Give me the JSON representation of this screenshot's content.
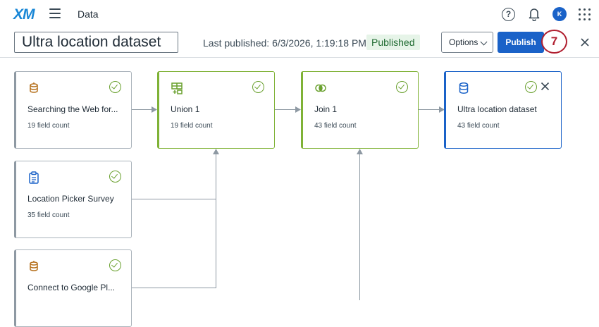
{
  "header": {
    "logo": "XM",
    "app_title": "Data",
    "avatar_initial": "K"
  },
  "toolbar": {
    "dataset_name": "Ultra location dataset",
    "last_published": "Last published: 6/3/2026, 1:19:18 PM",
    "status": "Published",
    "options_label": "Options",
    "publish_label": "Publish",
    "step_number": "7"
  },
  "nodes": [
    {
      "title": "Searching the Web for...",
      "count": "19 field count",
      "icon": "stack-coins-icon",
      "status": "check-icon"
    },
    {
      "title": "Union 1",
      "count": "19 field count",
      "icon": "union-table-icon",
      "status": "check-icon"
    },
    {
      "title": "Join 1",
      "count": "43 field count",
      "icon": "join-circles-icon",
      "status": "check-icon"
    },
    {
      "title": "Ultra location dataset",
      "count": "43 field count",
      "icon": "database-icon",
      "status": "check-icon"
    },
    {
      "title": "Location Picker Survey",
      "count": "35 field count",
      "icon": "survey-clipboard-icon",
      "status": "check-icon"
    },
    {
      "title": "Connect to Google Pl...",
      "count": "",
      "icon": "stack-coins-icon",
      "status": "check-icon"
    }
  ],
  "colors": {
    "brand": "#1a87d6",
    "primary_button": "#1a62c8",
    "transform_border": "#7fb236",
    "output_border": "#1a62c8",
    "status_badge_bg": "#e6f4e8",
    "step_marker": "#b01e2f"
  }
}
